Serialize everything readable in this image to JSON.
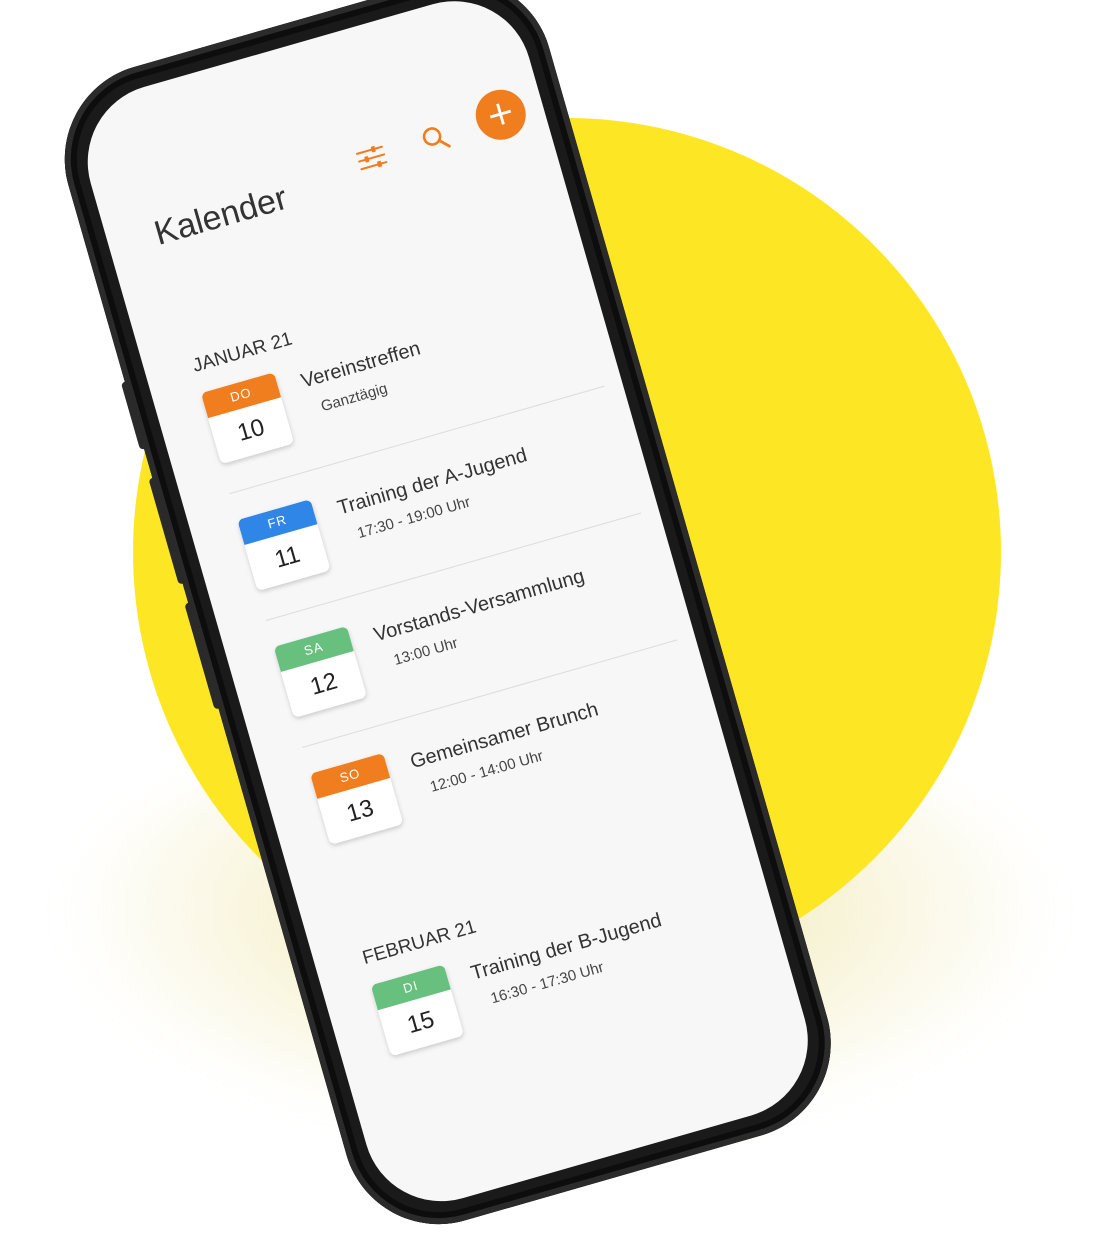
{
  "colors": {
    "accent": "#f07d1e",
    "orange": "#f07d1e",
    "blue": "#2f86e6",
    "green": "#67c07d",
    "background_disc": "#fde725"
  },
  "header": {
    "title": "Kalender",
    "filter_icon": "sliders-icon",
    "search_icon": "search-icon",
    "add_label": "+"
  },
  "sections": [
    {
      "month": "JANUAR 21",
      "events": [
        {
          "dow": "DO",
          "day": "10",
          "color": "orange",
          "title": "Vereinstreffen",
          "time": "Ganztägig"
        },
        {
          "dow": "FR",
          "day": "11",
          "color": "blue",
          "title": "Training der A-Jugend",
          "time": "17:30 - 19:00 Uhr"
        },
        {
          "dow": "SA",
          "day": "12",
          "color": "green",
          "title": "Vorstands-Versammlung",
          "time": "13:00  Uhr"
        },
        {
          "dow": "SO",
          "day": "13",
          "color": "orange",
          "title": "Gemeinsamer Brunch",
          "time": "12:00 - 14:00 Uhr"
        }
      ]
    },
    {
      "month": "FEBRUAR 21",
      "events": [
        {
          "dow": "DI",
          "day": "15",
          "color": "green",
          "title": "Training der B-Jugend",
          "time": "16:30 - 17:30 Uhr"
        }
      ]
    }
  ]
}
